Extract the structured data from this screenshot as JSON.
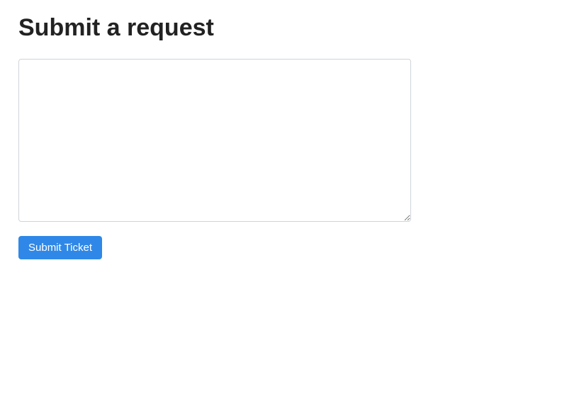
{
  "header": {
    "title": "Submit a request"
  },
  "form": {
    "textarea_value": "",
    "textarea_placeholder": "",
    "submit_label": "Submit Ticket"
  }
}
